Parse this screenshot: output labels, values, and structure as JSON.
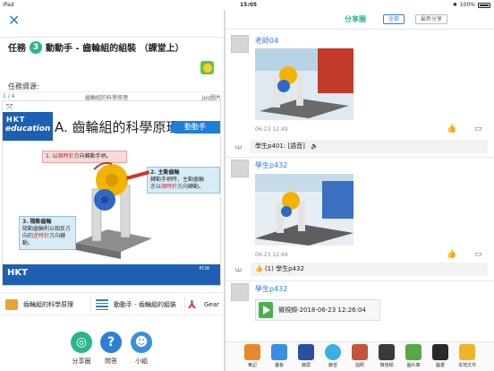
{
  "status": {
    "device": "iPad",
    "time": "15:05",
    "battery": "100%"
  },
  "left": {
    "task_prefix": "任務",
    "task_number": "3",
    "task_title": "動動手 - 齒輪組的組裝 （課堂上）",
    "resources_label": "任務資源:",
    "viewer": {
      "page": "1 / 4",
      "name": "齒輪組的科學原理",
      "type": "jpg圖片"
    },
    "slide": {
      "logo_top": "HKT",
      "logo_main": "education",
      "heading": "A. 齒輪組的科學原理",
      "tag": "動動手",
      "callout1_prefix": "1. 以",
      "callout1_red": "順時針",
      "callout1_suffix": "方向轉動手柄。",
      "callout2_title": "2. 主動齒輪",
      "callout2_line1": "轉動手柄時，主動齒輪",
      "callout2_line2_prefix": "亦以",
      "callout2_line2_red": "順時針",
      "callout2_line2_suffix": "方向轉動。",
      "callout3_title": "3. 隨動齒輪",
      "callout3_line1": "隨動齒輪則以相反方",
      "callout3_line2_prefix": "向的",
      "callout3_line2_red": "逆時針",
      "callout3_line2_suffix": "方向轉動。",
      "footer_logo": "HKT",
      "footer_right": "PCW"
    },
    "resources": [
      {
        "label": "齒輪組的科學原理",
        "icon": "image-file-icon"
      },
      {
        "label": "動動手 - 齒輪組的組裝",
        "icon": "document-lines-icon"
      },
      {
        "label": "Gear",
        "icon": "pdf-icon"
      }
    ],
    "actions": [
      {
        "label": "分享圈",
        "color": "#2bb58a"
      },
      {
        "label": "問答",
        "color": "#2f7fd6"
      },
      {
        "label": "小組",
        "color": "#3a8fe0"
      }
    ]
  },
  "right": {
    "title": "分享圈",
    "filter_all": "全部",
    "filter_latest": "最新分享",
    "posts": [
      {
        "author": "老師04",
        "time": "06-23 12:49",
        "comment": "學生p401: [語音]"
      },
      {
        "author": "學生p432",
        "time": "06-23 12:49",
        "comment": "(1) 學生p432"
      },
      {
        "author": "學生p432",
        "video": "微視頻-2018-06-23 12:26:04"
      }
    ],
    "tools": [
      "筆記",
      "畫板",
      "錄屏",
      "錄音",
      "拍照",
      "微視頻",
      "圖片庫",
      "圖書",
      "本地文件"
    ]
  }
}
